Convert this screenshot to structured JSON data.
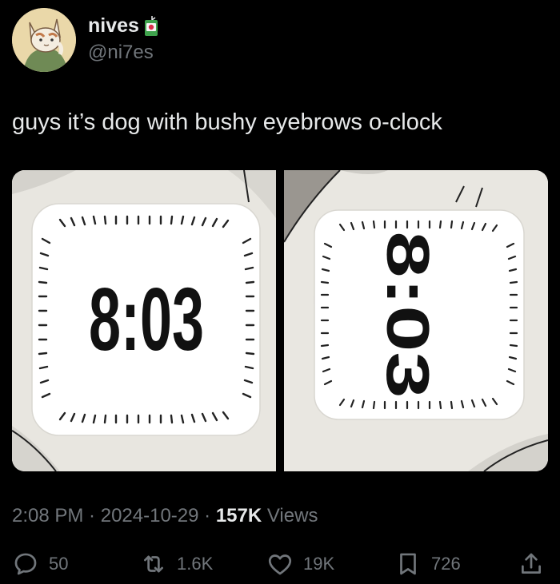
{
  "author": {
    "name": "nives",
    "name_emoji": "juice-box-emoji",
    "handle": "@ni7es"
  },
  "tweet": {
    "text": "guys it’s dog with bushy eyebrows o-clock"
  },
  "media": {
    "left_clock_time": "8:03",
    "right_clock_time": "8:03"
  },
  "meta": {
    "time": "2:08 PM",
    "sep1": " · ",
    "date": "2024-10-29",
    "sep2": " · ",
    "views_count": "157K",
    "views_label": " Views"
  },
  "actions": {
    "replies": "50",
    "reposts": "1.6K",
    "likes": "19K",
    "bookmarks": "726"
  },
  "colors": {
    "background": "#000000",
    "text_primary": "#e7e9ea",
    "text_secondary": "#71767b"
  }
}
